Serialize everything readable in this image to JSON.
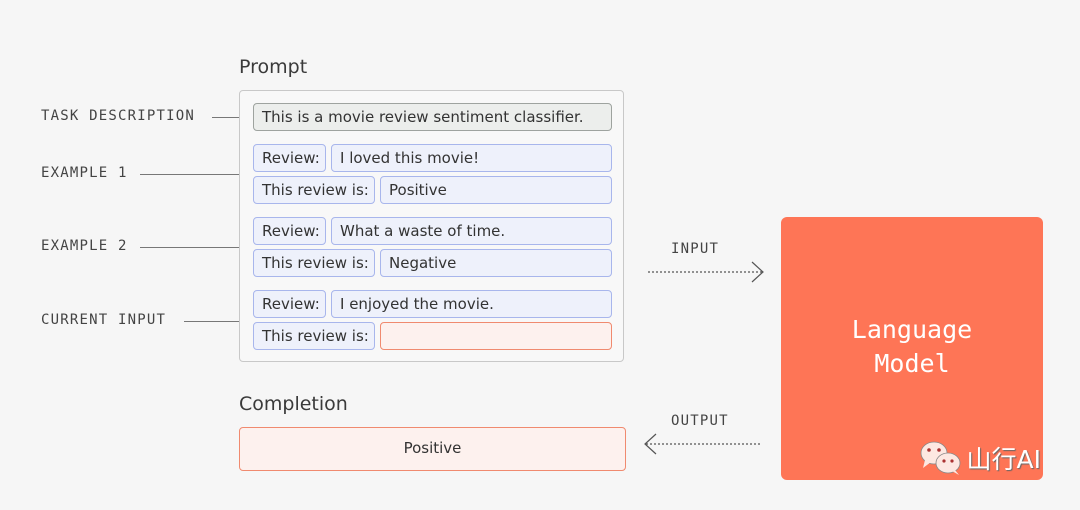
{
  "prompt": {
    "title": "Prompt",
    "task_description": "This is a movie review sentiment classifier.",
    "examples": [
      {
        "review_label": "Review:",
        "review_text": "I loved this movie!",
        "result_label": "This review is:",
        "result_value": "Positive"
      },
      {
        "review_label": "Review:",
        "review_text": "What a waste of time.",
        "result_label": "This review is:",
        "result_value": "Negative"
      }
    ],
    "current_input": {
      "review_label": "Review:",
      "review_text": "I enjoyed the movie.",
      "result_label": "This review is:",
      "result_value": ""
    }
  },
  "side_labels": {
    "task_description": "TASK DESCRIPTION",
    "example_1": "EXAMPLE 1",
    "example_2": "EXAMPLE 2",
    "current_input": "CURRENT INPUT"
  },
  "completion": {
    "title": "Completion",
    "value": "Positive"
  },
  "arrows": {
    "input": "INPUT",
    "output": "OUTPUT"
  },
  "model": {
    "line1": "Language",
    "line2": "Model",
    "color": "#fe7556"
  },
  "watermark": {
    "text": "山行AI",
    "icon": "wechat-icon"
  },
  "colors": {
    "blue_chip_border": "#a8b6ec",
    "red_chip_border": "#f08a6f",
    "background": "#f6f6f6"
  }
}
